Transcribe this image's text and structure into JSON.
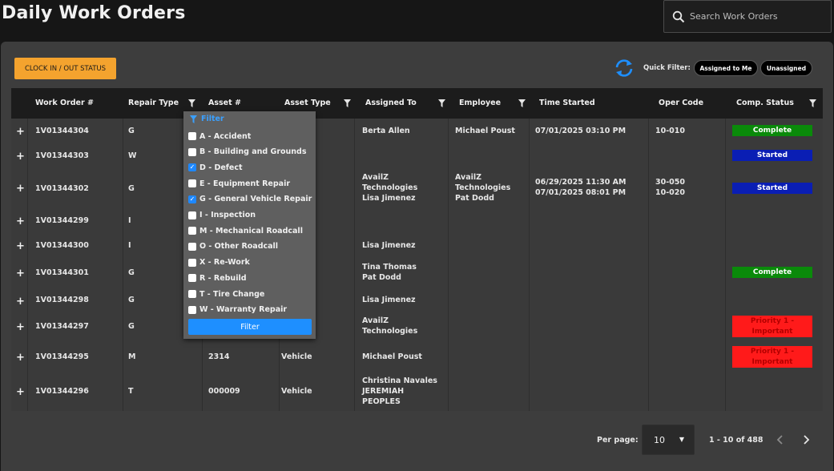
{
  "header": {
    "title": "Daily Work Orders",
    "search_placeholder": "Search Work Orders"
  },
  "toolbar": {
    "clock_label": "CLOCK IN / OUT STATUS",
    "quick_filter_label": "Quick Filter:",
    "assigned_label": "Assigned to Me",
    "unassigned_label": "Unassigned"
  },
  "columns": [
    "Work Order #",
    "Repair Type",
    "Asset #",
    "Asset Type",
    "Assigned To",
    "Employee",
    "Time Started",
    "Oper Code",
    "Comp. Status"
  ],
  "rows": [
    {
      "wo": "1V01344304",
      "repair": "G",
      "asset": "",
      "asset_type": "",
      "assigned": [
        "Berta Allen"
      ],
      "employee": [
        "Michael Poust"
      ],
      "time": [
        "07/01/2025 03:10 PM"
      ],
      "oper": [
        "10-010"
      ],
      "status": "Complete",
      "status_color": "#0a8a0a"
    },
    {
      "wo": "1V01344303",
      "repair": "W",
      "asset": "",
      "asset_type": "",
      "assigned": [],
      "employee": [],
      "time": [],
      "oper": [],
      "status": "Started",
      "status_color": "#0a1eb4"
    },
    {
      "wo": "1V01344302",
      "repair": "G",
      "asset": "",
      "asset_type": "",
      "assigned": [
        "AvailZ",
        "Technologies",
        "Lisa Jimenez"
      ],
      "employee": [
        "AvailZ",
        "Technologies",
        "Pat Dodd"
      ],
      "time": [
        "06/29/2025 11:30 AM",
        "07/01/2025 08:01 PM"
      ],
      "oper": [
        "30-050",
        "10-020"
      ],
      "status": "Started",
      "status_color": "#0a1eb4"
    },
    {
      "wo": "1V01344299",
      "repair": "I",
      "asset": "",
      "asset_type": "",
      "assigned": [],
      "employee": [],
      "time": [],
      "oper": [],
      "status": "",
      "status_color": ""
    },
    {
      "wo": "1V01344300",
      "repair": "I",
      "asset": "",
      "asset_type": "",
      "assigned": [
        "Lisa Jimenez"
      ],
      "employee": [],
      "time": [],
      "oper": [],
      "status": "",
      "status_color": ""
    },
    {
      "wo": "1V01344301",
      "repair": "G",
      "asset": "",
      "asset_type": "",
      "assigned": [
        "Tina Thomas",
        "Pat Dodd"
      ],
      "employee": [],
      "time": [],
      "oper": [],
      "status": "Complete",
      "status_color": "#0a8a0a"
    },
    {
      "wo": "1V01344298",
      "repair": "G",
      "asset": "",
      "asset_type": "",
      "assigned": [
        "Lisa Jimenez"
      ],
      "employee": [],
      "time": [],
      "oper": [],
      "status": "",
      "status_color": ""
    },
    {
      "wo": "1V01344297",
      "repair": "G",
      "asset": "",
      "asset_type": "",
      "assigned": [
        "AvailZ",
        "Technologies"
      ],
      "employee": [],
      "time": [],
      "oper": [],
      "status": "Priority 1 - Important",
      "status_color": "#ff1a1a"
    },
    {
      "wo": "1V01344295",
      "repair": "M",
      "asset": "2314",
      "asset_type": "Vehicle",
      "assigned": [
        "Michael Poust"
      ],
      "employee": [],
      "time": [],
      "oper": [],
      "status": "Priority 1 - Important",
      "status_color": "#ff1a1a"
    },
    {
      "wo": "1V01344296",
      "repair": "T",
      "asset": "000009",
      "asset_type": "Vehicle",
      "assigned": [
        "Christina Navales",
        "JEREMIAH",
        "PEOPLES"
      ],
      "employee": [],
      "time": [],
      "oper": [],
      "status": "",
      "status_color": ""
    }
  ],
  "filter_dropdown": {
    "title": "Filter",
    "options": [
      {
        "label": "A - Accident",
        "checked": false
      },
      {
        "label": "B - Building and Grounds",
        "checked": false
      },
      {
        "label": "D - Defect",
        "checked": true
      },
      {
        "label": "E - Equipment Repair",
        "checked": false
      },
      {
        "label": "G - General Vehicle Repair",
        "checked": true
      },
      {
        "label": "I - Inspection",
        "checked": false
      },
      {
        "label": "M - Mechanical Roadcall",
        "checked": false
      },
      {
        "label": "O - Other Roadcall",
        "checked": false
      },
      {
        "label": "X - Re-Work",
        "checked": false
      },
      {
        "label": "R - Rebuild",
        "checked": false
      },
      {
        "label": "T - Tire Change",
        "checked": false
      },
      {
        "label": "W - Warranty Repair",
        "checked": false
      }
    ],
    "button_label": "Filter"
  },
  "pager": {
    "per_page_label": "Per page:",
    "per_page_value": "10",
    "range": "1 - 10 of 488"
  },
  "colors": {
    "accent_orange": "#f4a32e",
    "accent_blue": "#1e8fff",
    "complete": "#0a8a0a",
    "started": "#0a1eb4",
    "priority": "#ff1a1a"
  },
  "icons": {
    "search": "search-icon",
    "refresh": "refresh-icon",
    "filter": "filter-icon",
    "plus": "plus-icon",
    "prev": "chevron-left-icon",
    "next": "chevron-right-icon"
  }
}
